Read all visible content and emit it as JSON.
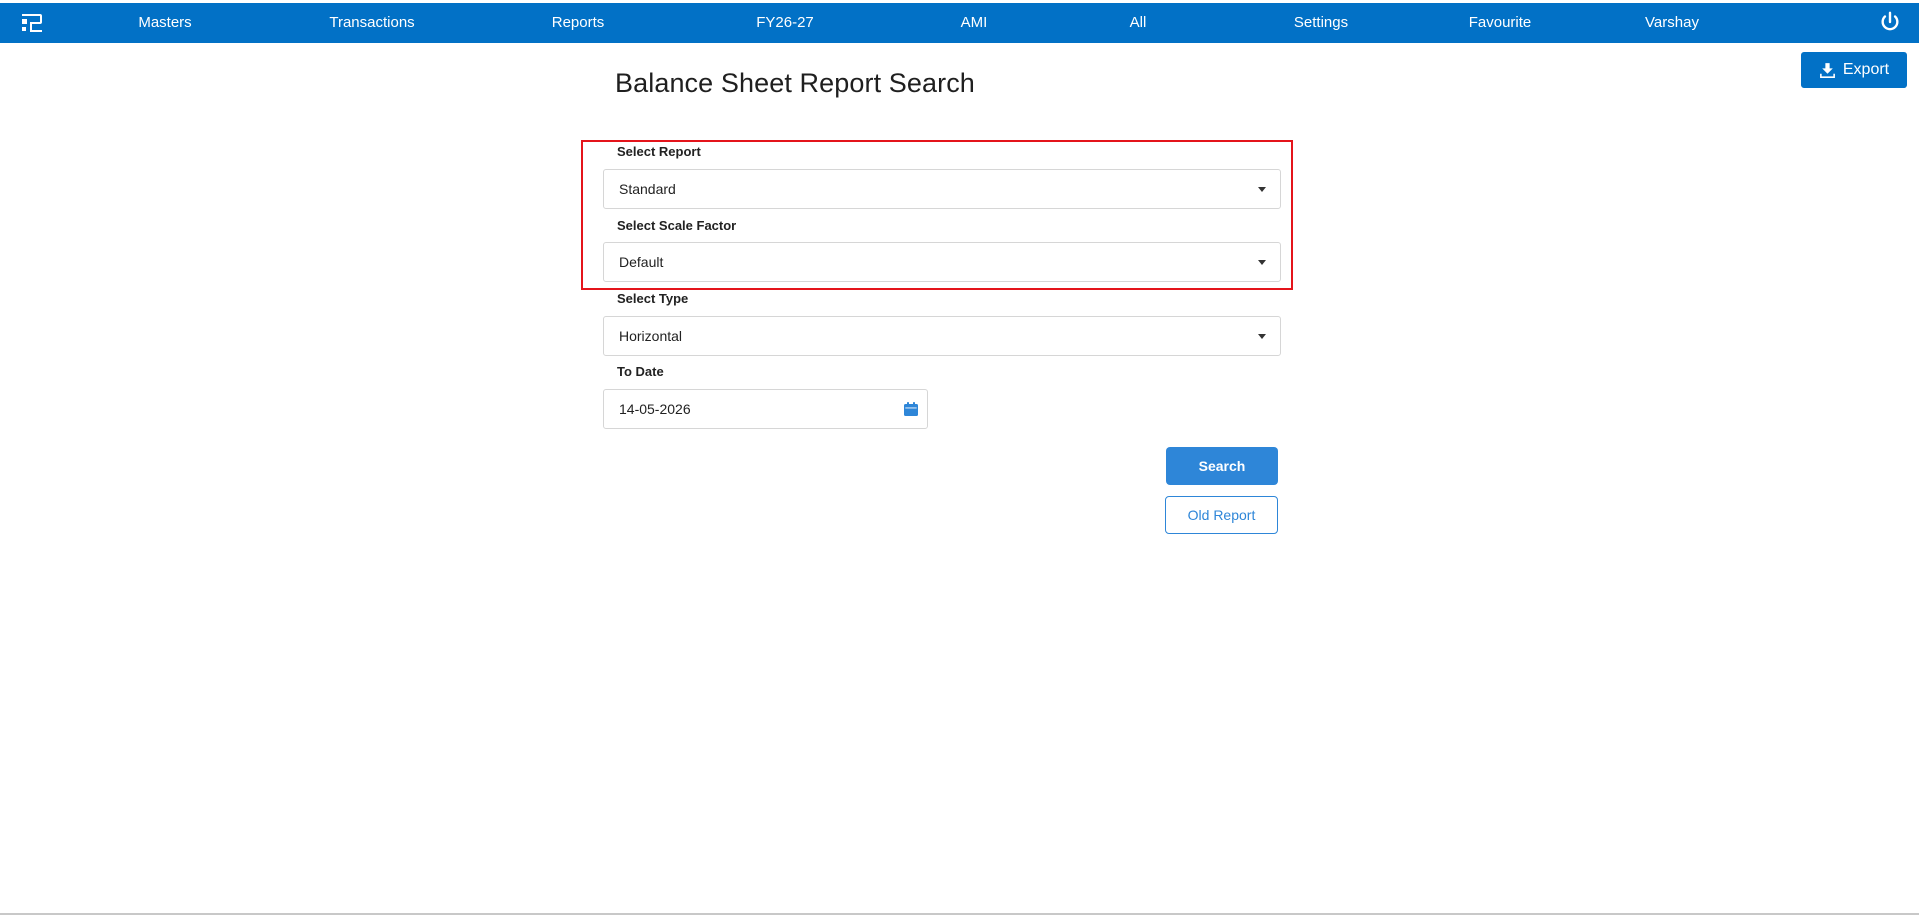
{
  "nav": {
    "logo_icon": "brand-logo-icon",
    "items": [
      "Masters",
      "Transactions",
      "Reports",
      "FY26-27",
      "AMI",
      "All",
      "Settings",
      "Favourite",
      "Varshay"
    ],
    "power_icon": "power-icon",
    "background_color": "#0271c6"
  },
  "toolbar": {
    "export_label": "Export",
    "export_icon": "download-icon"
  },
  "page": {
    "title": "Balance Sheet Report Search"
  },
  "form": {
    "report": {
      "label": "Select Report",
      "value": "Standard"
    },
    "scale_factor": {
      "label": "Select Scale Factor",
      "value": "Default"
    },
    "type": {
      "label": "Select Type",
      "value": "Horizontal"
    },
    "to_date": {
      "label": "To Date",
      "value": "14-05-2026",
      "icon": "calendar-icon"
    }
  },
  "actions": {
    "search_label": "Search",
    "old_report_label": "Old Report"
  },
  "colors": {
    "accent": "#0271c6",
    "button": "#2e86d8",
    "highlight_border": "#e4141b"
  }
}
